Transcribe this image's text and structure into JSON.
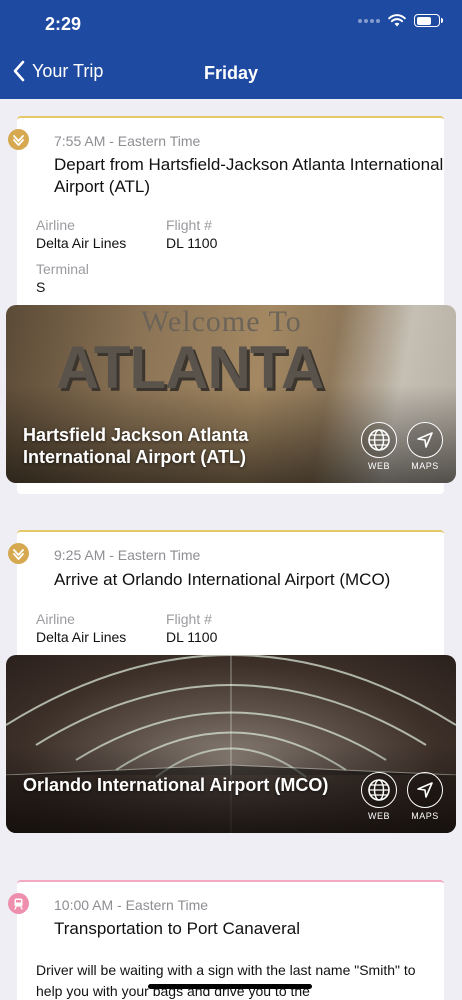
{
  "status_bar": {
    "time": "2:29"
  },
  "nav": {
    "back_label": "Your Trip",
    "title": "Friday"
  },
  "cards": [
    {
      "time": "7:55 AM - Eastern Time",
      "title": "Depart from Hartsfield-Jackson Atlanta International Airport (ATL)",
      "airline_label": "Airline",
      "airline": "Delta Air Lines",
      "flight_label": "Flight #",
      "flight": "DL 1100",
      "terminal_label": "Terminal",
      "terminal": "S",
      "image_text": "Welcome To ATLANTA",
      "place_name": "Hartsfield Jackson Atlanta International Airport (ATL)",
      "web_label": "WEB",
      "maps_label": "MAPS"
    },
    {
      "time": "9:25 AM - Eastern Time",
      "title": "Arrive at Orlando International Airport (MCO)",
      "airline_label": "Airline",
      "airline": "Delta Air Lines",
      "flight_label": "Flight #",
      "flight": "DL 1100",
      "place_name": "Orlando International Airport (MCO)",
      "web_label": "WEB",
      "maps_label": "MAPS"
    },
    {
      "time": "10:00 AM - Eastern Time",
      "title": "Transportation to Port Canaveral",
      "description": "Driver will be waiting with a sign with the last name \"Smith\" to help you with your bags and drive you to the"
    }
  ],
  "colors": {
    "nav_bg": "#1f4aa1",
    "flight_accent": "#d6a850",
    "transport_accent": "#ef8fae"
  }
}
